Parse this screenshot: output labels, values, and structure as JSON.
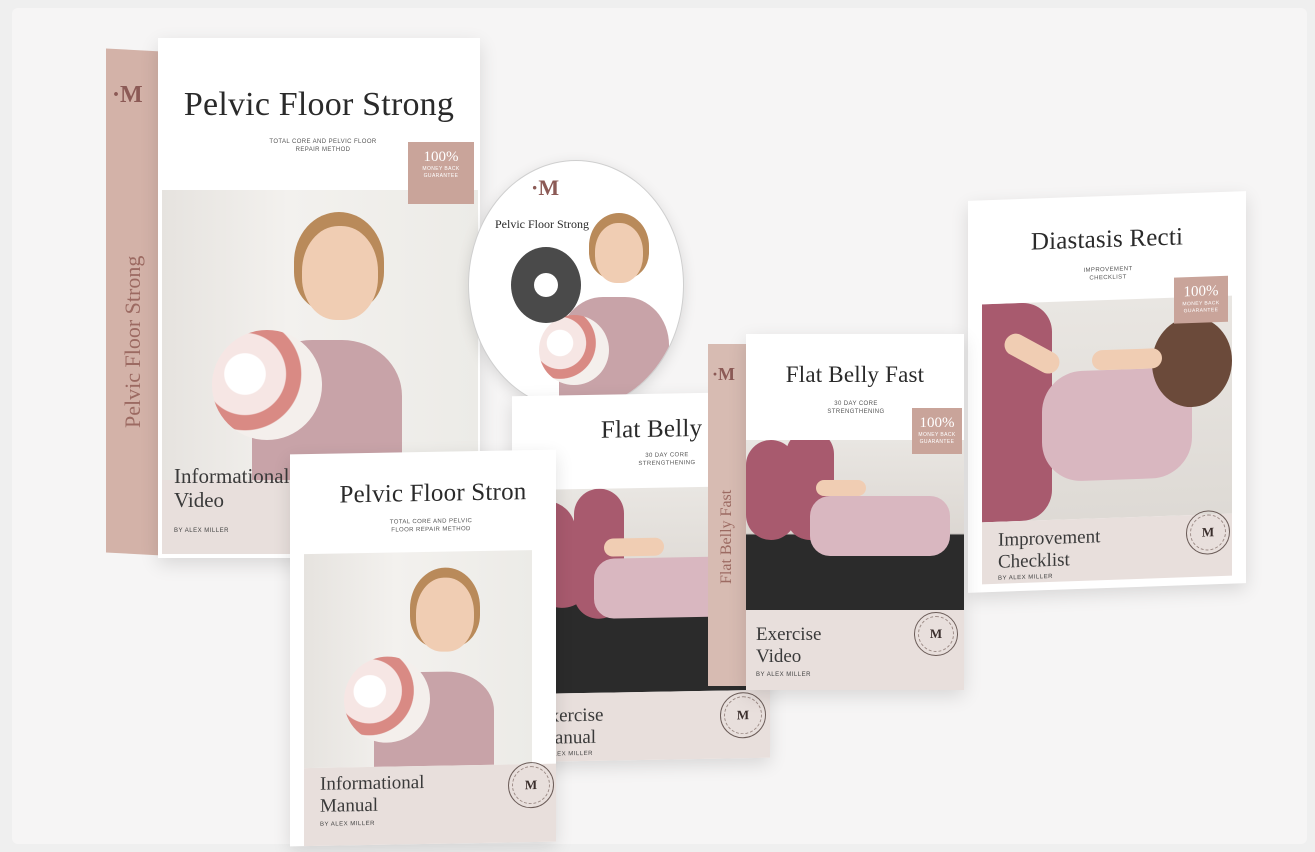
{
  "brand": {
    "logo": "·M"
  },
  "video_box": {
    "title": "Pelvic Floor Strong",
    "subtitle": "TOTAL CORE AND PELVIC FLOOR REPAIR METHOD",
    "spine": "Pelvic Floor Strong",
    "badge_pct": "100%",
    "badge_text": "MONEY BACK GUARANTEE",
    "label": "Informational Video",
    "author": "BY ALEX MILLER"
  },
  "disc": {
    "title": "Pelvic Floor Strong"
  },
  "info_manual": {
    "title": "Pelvic Floor Stron",
    "subtitle": "TOTAL CORE AND PELVIC FLOOR REPAIR METHOD",
    "label": "Informational Manual",
    "author": "BY ALEX MILLER"
  },
  "exercise_manual": {
    "title": "Flat Belly Fast",
    "subtitle": "30 DAY CORE STRENGTHENING",
    "label": "Exercise Manual",
    "author": "BY ALEX MILLER"
  },
  "exercise_video": {
    "title": "Flat Belly Fast",
    "subtitle": "30 DAY CORE STRENGTHENING",
    "spine": "Flat Belly Fast",
    "badge_pct": "100%",
    "badge_text": "MONEY BACK GUARANTEE",
    "label": "Exercise Video",
    "author": "BY ALEX MILLER"
  },
  "checklist": {
    "title": "Diastasis Recti",
    "subtitle": "IMPROVEMENT CHECKLIST",
    "badge_pct": "100%",
    "badge_text": "MONEY BACK GUARANTEE",
    "label": "Improvement Checklist",
    "author": "BY ALEX MILLER"
  },
  "colors": {
    "accent": "#c9a49a",
    "spine": "#d9bfb6",
    "logo": "#8c5a56"
  }
}
